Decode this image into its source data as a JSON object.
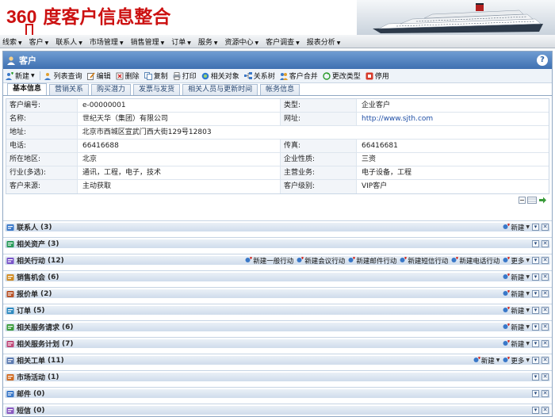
{
  "slide": {
    "title_num": "360",
    "title_text": "度客户信息整合"
  },
  "menubar": {
    "items": [
      "线索",
      "客户",
      "联系人",
      "市场管理",
      "销售管理",
      "订单",
      "服务",
      "资源中心",
      "客户调查",
      "报表分析"
    ]
  },
  "window": {
    "title": "客户",
    "help": "?"
  },
  "toolbar": {
    "new": "新建",
    "list_query": "列表查询",
    "edit": "编辑",
    "delete": "删除",
    "copy": "复制",
    "print": "打印",
    "related_object": "相关对象",
    "relationship": "关系树",
    "merge": "客户合并",
    "change_type": "更改类型",
    "disable": "停用"
  },
  "tabs": [
    "基本信息",
    "营销关系",
    "购买潜力",
    "发票与发货",
    "相关人员与更新时间",
    "帐务信息"
  ],
  "detail": {
    "customer_no_label": "客户编号:",
    "customer_no": "e-00000001",
    "type_label": "类型:",
    "type": "企业客户",
    "name_label": "名称:",
    "name": "世纪天华（集团）有限公司",
    "website_label": "网址:",
    "website": "http://www.sjth.com",
    "address_label": "地址:",
    "address": "北京市西城区宣武门西大街129号12803",
    "phone_label": "电话:",
    "phone": "66416688",
    "fax_label": "传真:",
    "fax": "66416681",
    "region_label": "所在地区:",
    "region": "北京",
    "nature_label": "企业性质:",
    "nature": "三资",
    "industry_label": "行业(多选):",
    "industry": "通讯，工程，电子，技术",
    "main_business_label": "主营业务:",
    "main_business": "电子设备，工程",
    "source_label": "客户来源:",
    "source": "主动获取",
    "level_label": "客户级别:",
    "level": "VIP客户"
  },
  "sections": [
    {
      "name": "联系人",
      "count": "(3)",
      "actions": [
        "新建"
      ]
    },
    {
      "name": "相关资产",
      "count": "(3)",
      "actions": []
    },
    {
      "name": "相关行动",
      "count": "(12)",
      "actions": [
        "新建一般行动",
        "新建会议行动",
        "新建邮件行动",
        "新建短信行动",
        "新建电话行动",
        "更多"
      ]
    },
    {
      "name": "销售机会",
      "count": "(6)",
      "actions": [
        "新建"
      ]
    },
    {
      "name": "报价单",
      "count": "(2)",
      "actions": [
        "新建"
      ]
    },
    {
      "name": "订单",
      "count": "(5)",
      "actions": [
        "新建"
      ]
    },
    {
      "name": "相关服务请求",
      "count": "(6)",
      "actions": [
        "新建"
      ]
    },
    {
      "name": "相关服务计划",
      "count": "(7)",
      "actions": [
        "新建"
      ]
    },
    {
      "name": "相关工单",
      "count": "(11)",
      "actions": [
        "新建",
        "更多"
      ]
    },
    {
      "name": "市场活动",
      "count": "(1)",
      "actions": []
    },
    {
      "name": "邮件",
      "count": "(0)",
      "actions": []
    },
    {
      "name": "短信",
      "count": "(0)",
      "actions": []
    }
  ],
  "colors": {
    "title_red": "#cc1111",
    "window_blue": "#3e70b1",
    "section_bar": "#cfdcec"
  }
}
